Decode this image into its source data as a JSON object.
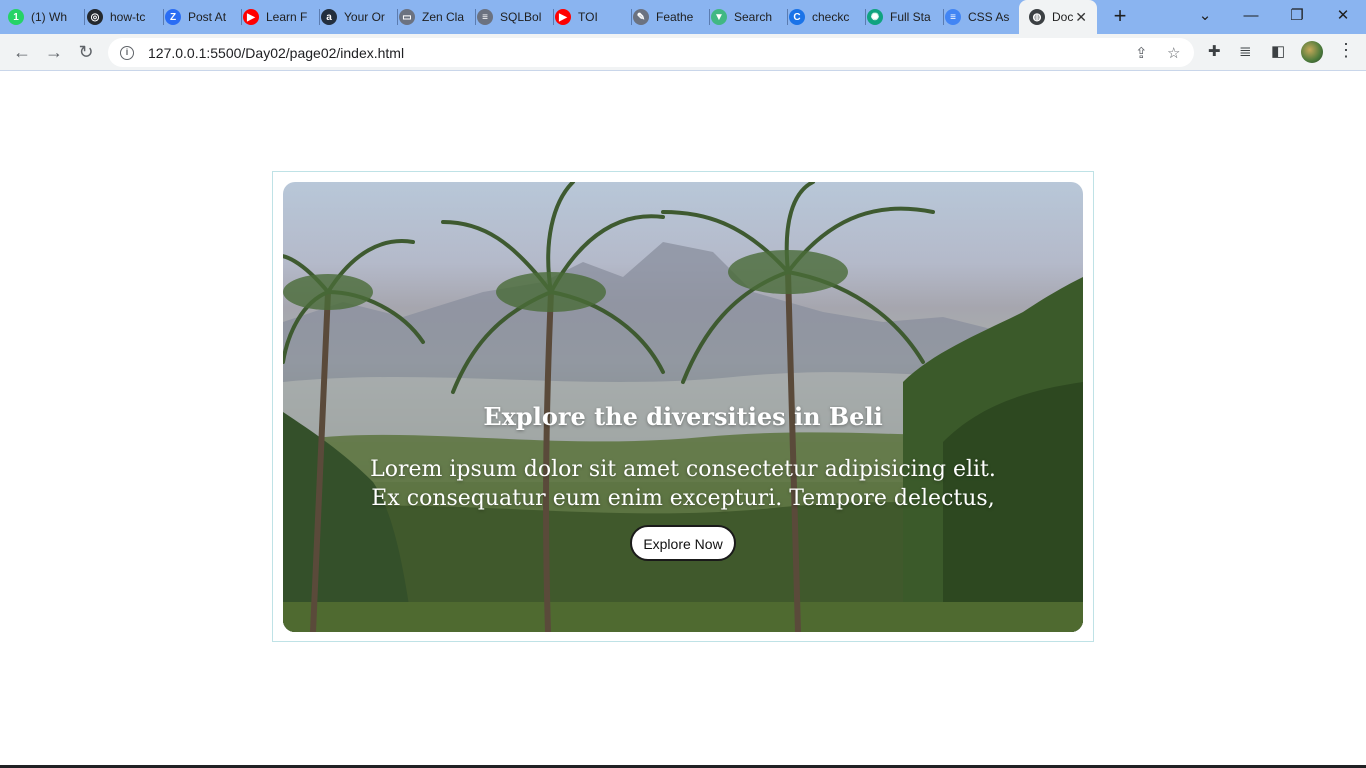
{
  "browser": {
    "tabs": [
      {
        "label": "(1) Wh",
        "icon": "whatsapp-icon",
        "color": "#25d366",
        "glyph": "1"
      },
      {
        "label": "how-tc",
        "icon": "github-icon",
        "color": "#24292e",
        "glyph": "◎"
      },
      {
        "label": "Post At",
        "icon": "zoho-icon",
        "color": "#2a6df4",
        "glyph": "Z"
      },
      {
        "label": "Learn F",
        "icon": "youtube-icon",
        "color": "#ff0000",
        "glyph": "▶"
      },
      {
        "label": "Your Or",
        "icon": "amazon-icon",
        "color": "#232f3e",
        "glyph": "a"
      },
      {
        "label": "Zen Cla",
        "icon": "zen-class-icon",
        "color": "#6b7280",
        "glyph": "▭"
      },
      {
        "label": "SQLBol",
        "icon": "sqlbolt-icon",
        "color": "#6b7280",
        "glyph": "≡"
      },
      {
        "label": "TOI",
        "icon": "youtube-icon",
        "color": "#ff0000",
        "glyph": "▶"
      },
      {
        "label": "Feathe",
        "icon": "feather-icon",
        "color": "#6b7280",
        "glyph": "✎"
      },
      {
        "label": "Search",
        "icon": "vue-icon",
        "color": "#41b883",
        "glyph": "▼"
      },
      {
        "label": "checkc",
        "icon": "chrome-c-icon",
        "color": "#1a73e8",
        "glyph": "C"
      },
      {
        "label": "Full Sta",
        "icon": "openai-icon",
        "color": "#10a37f",
        "glyph": "✺"
      },
      {
        "label": "CSS As",
        "icon": "google-docs-icon",
        "color": "#4285f4",
        "glyph": "≡"
      }
    ],
    "active_tab": {
      "label": "Doc",
      "icon": "globe-icon"
    },
    "new_tab_label": "+",
    "url": "127.0.0.1:5500/Day02/page02/index.html"
  },
  "hero": {
    "title": "Explore the diversities in Beli",
    "body": "Lorem ipsum dolor sit amet consectetur adipisicing elit. Ex consequatur eum enim excepturi. Tempore delectus,",
    "button_label": "Explore Now"
  },
  "colors": {
    "tabstrip": "#8ab4f0",
    "toolbar": "#f1f3f4",
    "frame_border": "#bfe2e6"
  }
}
